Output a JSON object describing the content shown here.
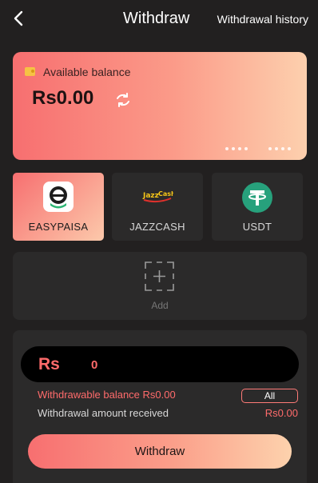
{
  "header": {
    "title": "Withdraw",
    "history_label": "Withdrawal history",
    "back_icon": "chevron-left-icon"
  },
  "balance_card": {
    "label": "Available balance",
    "amount": "Rs0.00",
    "wallet_icon": "wallet-icon",
    "refresh_icon": "refresh-icon"
  },
  "methods": [
    {
      "label": "EASYPAISA",
      "icon": "easypaisa-icon",
      "active": true
    },
    {
      "label": "JAZZCASH",
      "icon": "jazzcash-icon",
      "active": false
    },
    {
      "label": "USDT",
      "icon": "tether-icon",
      "active": false
    }
  ],
  "add_card": {
    "label": "Add",
    "icon": "add-icon"
  },
  "form": {
    "currency_symbol": "Rs",
    "amount_value": "0",
    "withdrawable_label": "Withdrawable balance Rs0.00",
    "all_label": "All",
    "received_label": "Withdrawal amount received",
    "received_value": "Rs0.00",
    "submit_label": "Withdraw"
  },
  "colors": {
    "background": "#222020",
    "card": "#2b2a2a",
    "accent": "#ff6b6b",
    "gradient_start": "#f76f70",
    "gradient_end": "#fdd0ae"
  }
}
